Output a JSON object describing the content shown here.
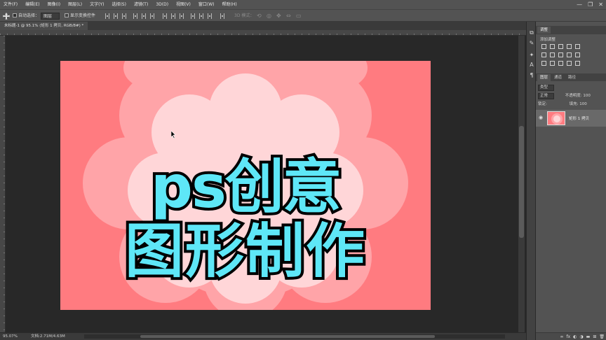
{
  "menu": [
    "文件(F)",
    "编辑(E)",
    "图像(I)",
    "图层(L)",
    "文字(Y)",
    "选择(S)",
    "滤镜(T)",
    "3D(D)",
    "视图(V)",
    "窗口(W)",
    "帮助(H)"
  ],
  "window_controls": {
    "minimize": "—",
    "restore": "❐",
    "close": "✕"
  },
  "options": {
    "auto_select_label": "自动选择：",
    "auto_select_value": "图层",
    "show_transform_label": "显示变换控件",
    "mode_3d_label": "3D 模式："
  },
  "document_tab": "未标题-1 @ 95.1% (矩形 1 拷贝, RGB/8#) *",
  "canvas": {
    "title_line1": "ps创意",
    "title_line2": "图形制作",
    "colors": {
      "bg": "#ff7b80",
      "outer_flower": "#ffa4a8",
      "inner_flower": "#ffd6d8",
      "text_fill": "#5ee7f7",
      "text_stroke": "#000000"
    }
  },
  "status": {
    "zoom": "95.07%",
    "doc_size": "文档:2.71M/4.63M"
  },
  "panels": {
    "adjust_tab": "调整",
    "adjust_add": "添加调整",
    "layers_tab": "图层",
    "channels_tab": "通道",
    "paths_tab": "路径",
    "kind_filter": "类型",
    "blend_mode": "正常",
    "opacity_label": "不透明度:",
    "opacity_value": "100",
    "lock_label": "锁定:",
    "fill_label": "填充:",
    "fill_value": "100",
    "layer_name": "矩形 1 拷贝"
  },
  "footer_icons": [
    "link-icon",
    "fx-icon",
    "mask-icon",
    "adjustment-icon",
    "folder-icon",
    "new-layer-icon",
    "trash-icon"
  ]
}
